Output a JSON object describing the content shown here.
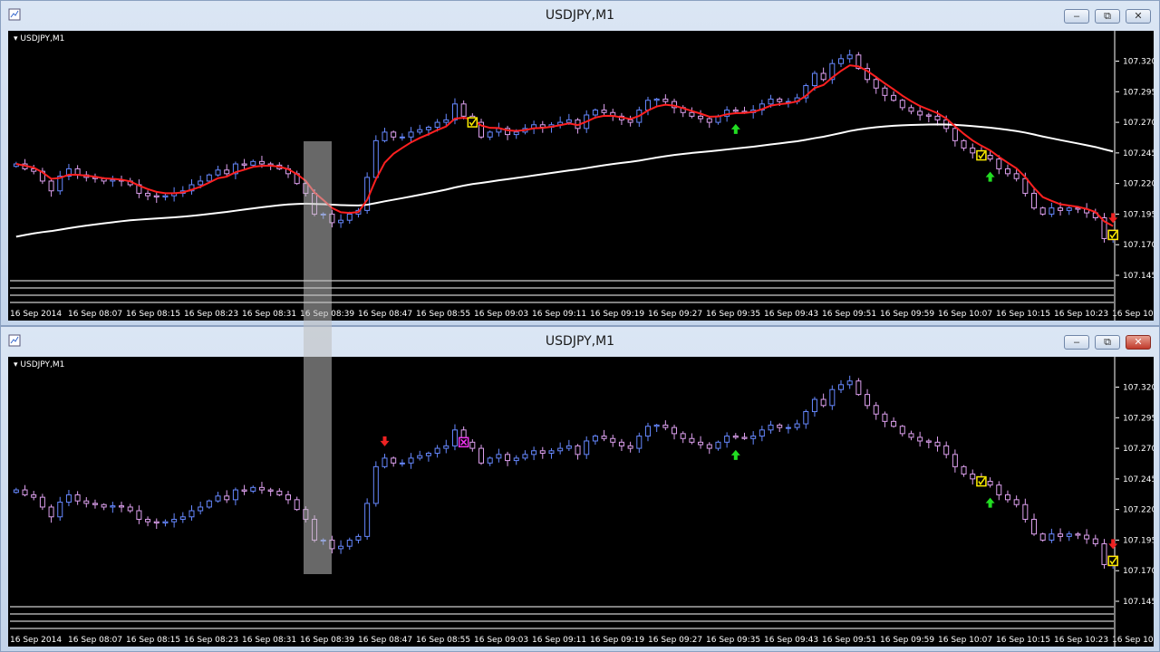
{
  "windows": [
    {
      "title": "USDJPY,M1",
      "symbol_label": "USDJPY,M1"
    },
    {
      "title": "USDJPY,M1",
      "symbol_label": "USDJPY,M1"
    }
  ],
  "controls": {
    "minimize": "–",
    "restore": "⧉",
    "close": "✕"
  },
  "price_labels": [
    "107.320",
    "107.295",
    "107.270",
    "107.245",
    "107.220",
    "107.195",
    "107.170",
    "107.145"
  ],
  "time_labels": [
    "16 Sep 2014",
    "16 Sep 08:07",
    "16 Sep 08:15",
    "16 Sep 08:23",
    "16 Sep 08:31",
    "16 Sep 08:39",
    "16 Sep 08:47",
    "16 Sep 08:55",
    "16 Sep 09:03",
    "16 Sep 09:11",
    "16 Sep 09:19",
    "16 Sep 09:27",
    "16 Sep 09:35",
    "16 Sep 09:43",
    "16 Sep 09:51",
    "16 Sep 09:59",
    "16 Sep 10:07",
    "16 Sep 10:15",
    "16 Sep 10:23",
    "16 Sep 10:"
  ],
  "colors": {
    "bull": "#6688ff",
    "bear": "#dda0ee",
    "fast_ma": "#ff2020",
    "slow_ma": "#ffffff",
    "up_arrow": "#22dd22",
    "down_arrow": "#ee2222",
    "check": "#ffee00",
    "x_mark": "#ee33ee"
  },
  "chart_data": {
    "type": "candlestick",
    "ylim": [
      107.145,
      107.33
    ],
    "close": [
      107.236,
      107.232,
      107.23,
      107.222,
      107.214,
      107.226,
      107.232,
      107.227,
      107.225,
      107.224,
      107.222,
      107.223,
      107.222,
      107.219,
      107.212,
      107.21,
      107.209,
      107.21,
      107.212,
      107.214,
      107.219,
      107.222,
      107.227,
      107.231,
      107.228,
      107.236,
      107.235,
      107.238,
      107.236,
      107.235,
      107.232,
      107.228,
      107.22,
      107.212,
      107.195,
      107.195,
      107.188,
      107.19,
      107.195,
      107.198,
      107.225,
      107.255,
      107.262,
      107.258,
      107.258,
      107.262,
      107.264,
      107.266,
      107.27,
      107.272,
      107.285,
      107.275,
      107.27,
      107.258,
      107.262,
      107.265,
      107.26,
      107.262,
      107.265,
      107.268,
      107.266,
      107.268,
      107.27,
      107.272,
      107.265,
      107.276,
      107.28,
      107.278,
      107.275,
      107.272,
      107.27,
      107.28,
      107.288,
      107.289,
      107.287,
      107.282,
      107.278,
      107.275,
      107.273,
      107.27,
      107.275,
      107.28,
      107.279,
      107.278,
      107.28,
      107.285,
      107.289,
      107.287,
      107.287,
      107.29,
      107.3,
      107.31,
      107.305,
      107.318,
      107.322,
      107.325,
      107.314,
      107.305,
      107.298,
      107.292,
      107.288,
      107.282,
      107.279,
      107.276,
      107.275,
      107.272,
      107.265,
      107.255,
      107.249,
      107.245,
      107.243,
      107.24,
      107.232,
      107.228,
      107.224,
      107.212,
      107.2,
      107.195,
      107.2,
      107.198,
      107.2,
      107.199,
      107.196,
      107.192,
      107.175,
      107.178
    ],
    "arrows": [
      {
        "window": 0,
        "index": 82,
        "dir": "up"
      },
      {
        "window": 0,
        "index": 111,
        "dir": "up"
      },
      {
        "window": 0,
        "index": 134,
        "dir": "down"
      },
      {
        "window": 1,
        "index": 42,
        "dir": "down"
      },
      {
        "window": 1,
        "index": 82,
        "dir": "up"
      },
      {
        "window": 1,
        "index": 111,
        "dir": "up"
      },
      {
        "window": 1,
        "index": 134,
        "dir": "down"
      }
    ],
    "markers": [
      {
        "window": 0,
        "index": 52,
        "kind": "check"
      },
      {
        "window": 0,
        "index": 110,
        "kind": "check"
      },
      {
        "window": 0,
        "index": 132,
        "kind": "x"
      },
      {
        "window": 0,
        "index": 150,
        "kind": "check"
      },
      {
        "window": 1,
        "index": 51,
        "kind": "x"
      },
      {
        "window": 1,
        "index": 110,
        "kind": "check"
      },
      {
        "window": 1,
        "index": 132,
        "kind": "x"
      },
      {
        "window": 1,
        "index": 150,
        "kind": "check"
      }
    ]
  }
}
